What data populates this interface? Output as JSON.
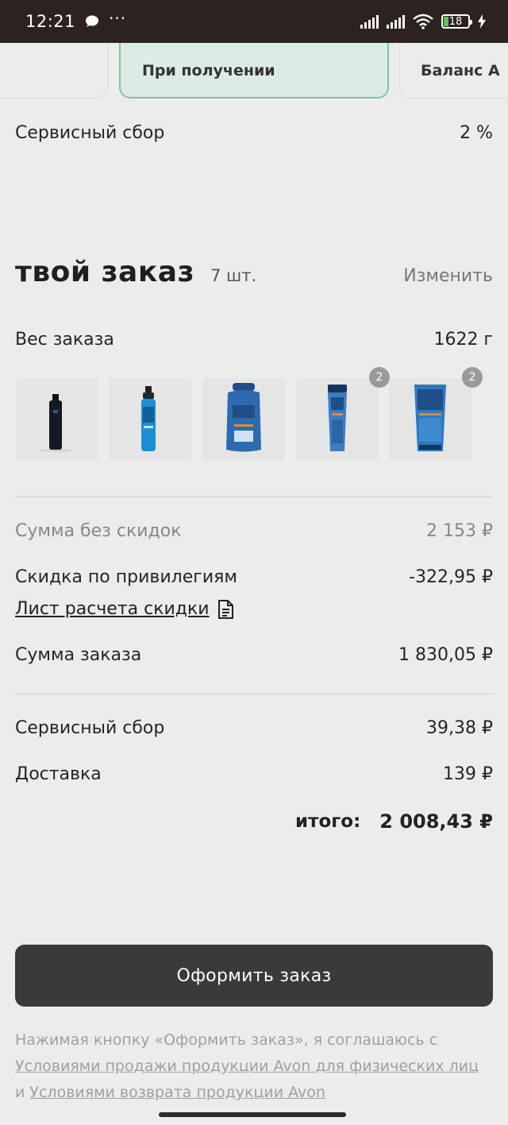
{
  "status_bar": {
    "time": "12:21",
    "dots": "···",
    "battery": "18"
  },
  "payment_options": {
    "on_receipt": "При получении",
    "balance": "Баланс А"
  },
  "service_fee_top": {
    "label": "Сервисный сбор",
    "value": "2 %"
  },
  "order": {
    "title": "твой заказ",
    "count": "7 шт.",
    "edit": "Изменить"
  },
  "weight": {
    "label": "Вес заказа",
    "value": "1622 г"
  },
  "products": [
    {
      "name": "product-1",
      "badge": ""
    },
    {
      "name": "product-2",
      "badge": ""
    },
    {
      "name": "product-3",
      "badge": ""
    },
    {
      "name": "product-4",
      "badge": "2"
    },
    {
      "name": "product-5",
      "badge": "2"
    }
  ],
  "summary": {
    "no_discount_label": "Сумма без скидок",
    "no_discount_value": "2 153 ₽",
    "privilege_label": "Скидка по привилегиям",
    "privilege_value": "-322,95 ₽",
    "discount_sheet_link": "Лист расчета скидки",
    "order_sum_label": "Сумма заказа",
    "order_sum_value": "1 830,05 ₽",
    "service_fee_label": "Сервисный сбор",
    "service_fee_value": "39,38 ₽",
    "delivery_label": "Доставка",
    "delivery_value": "139 ₽",
    "total_label": "итого:",
    "total_value": "2 008,43 ₽"
  },
  "cta": {
    "label": "Оформить заказ"
  },
  "legal": {
    "prefix": "Нажимая кнопку «Оформить заказ», я соглашаюсь с",
    "link1": "Условиями продажи продукции Avon для физических лиц",
    "middle": "и",
    "link2": "Условиями возврата продукции Avon"
  }
}
